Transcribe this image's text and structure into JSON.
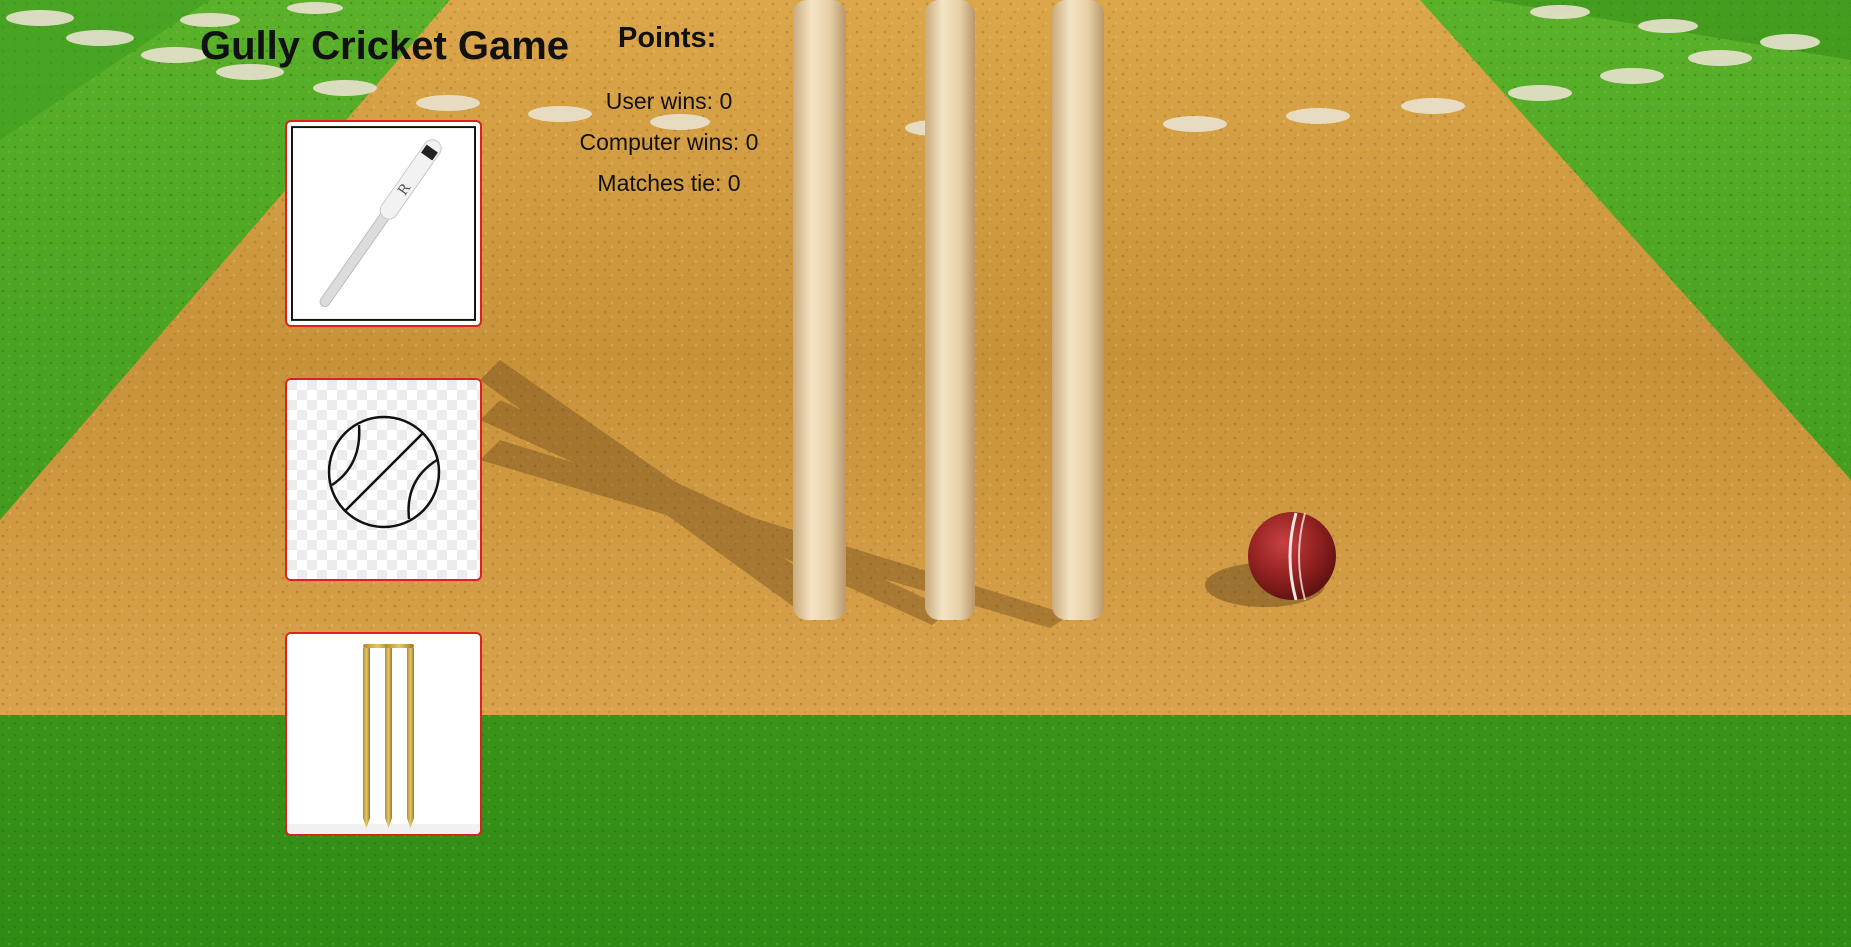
{
  "app": {
    "title": "Gully Cricket Game"
  },
  "scoreboard": {
    "heading": "Points:",
    "user_wins": "User wins: 0",
    "computer_wins": "Computer wins: 0",
    "ties": "Matches tie: 0"
  },
  "choices": [
    {
      "id": "bat",
      "icon": "bat-icon"
    },
    {
      "id": "ball",
      "icon": "ball-icon"
    },
    {
      "id": "stump",
      "icon": "stumps-icon"
    }
  ],
  "colors": {
    "grass": "#3e9a1c",
    "pitch": "#cf9a3f",
    "card_border": "#e0201c"
  }
}
